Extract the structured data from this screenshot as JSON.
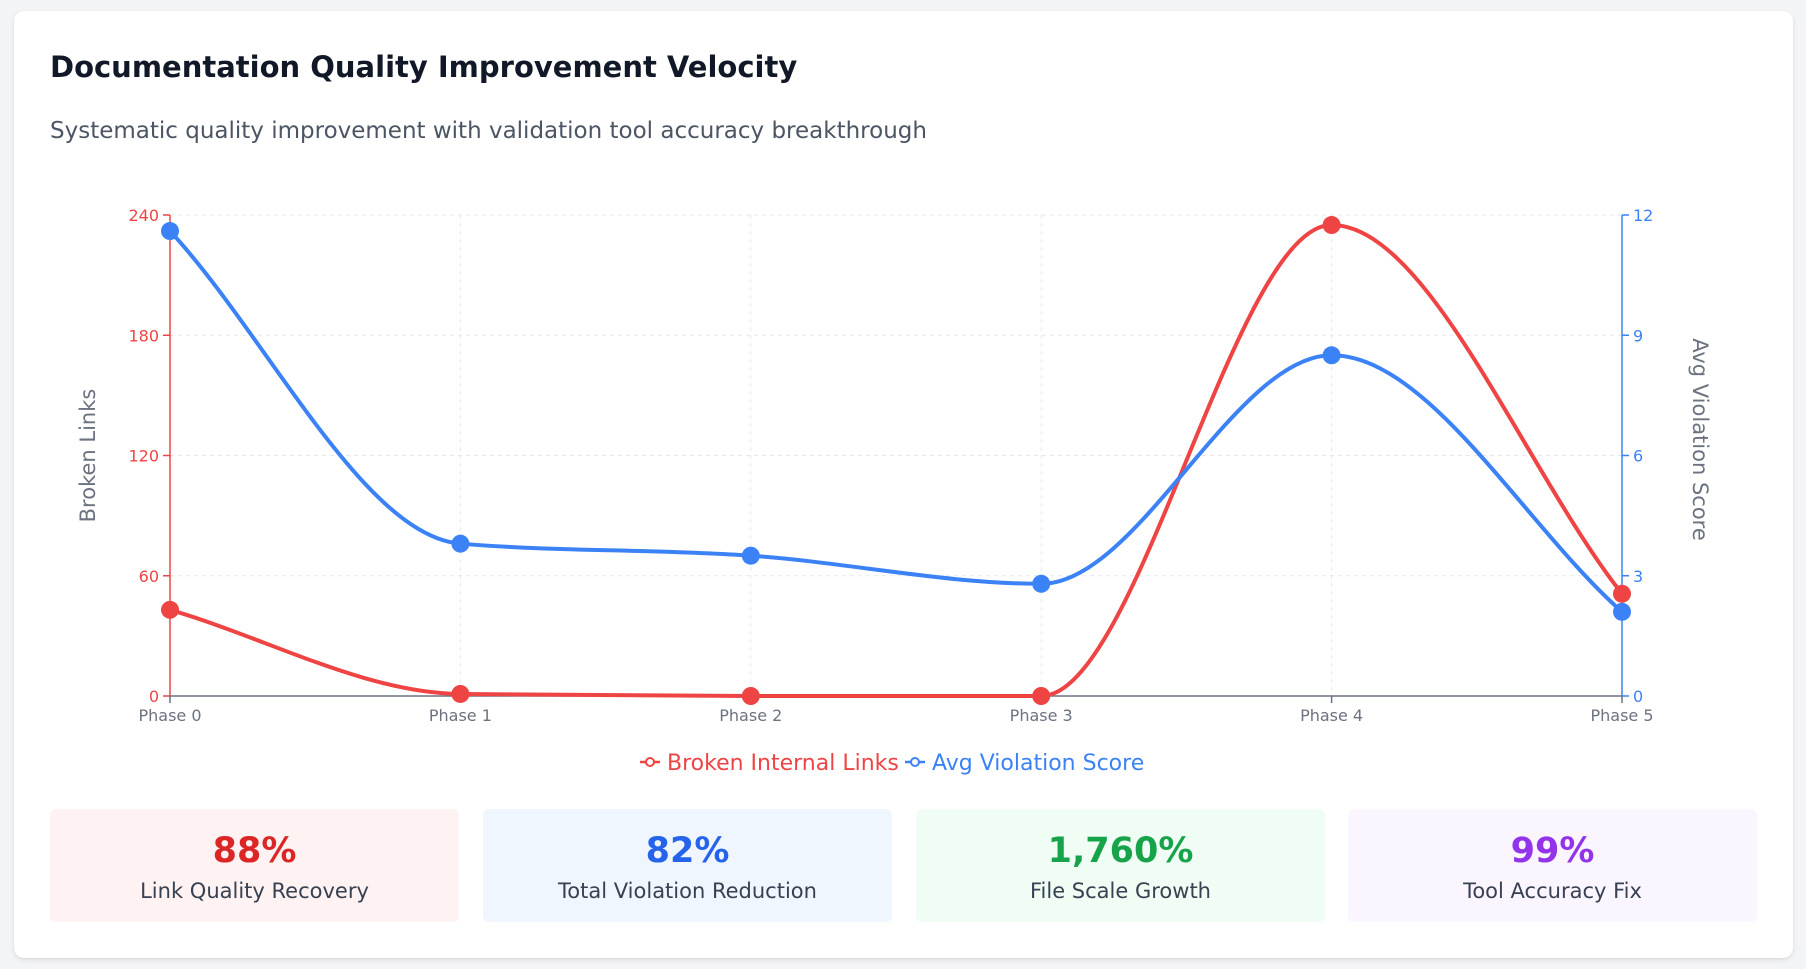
{
  "header": {
    "title": "Documentation Quality Improvement Velocity",
    "subtitle": "Systematic quality improvement with validation tool accuracy breakthrough"
  },
  "colors": {
    "broken_links": "#ef4444",
    "violation_score": "#3b82f6",
    "grid": "#e5e7eb",
    "axis": "#6b7280"
  },
  "chart_data": {
    "type": "line",
    "categories": [
      "Phase 0",
      "Phase 1",
      "Phase 2",
      "Phase 3",
      "Phase 4",
      "Phase 5"
    ],
    "series": [
      {
        "name": "Broken Internal Links",
        "axis": "left",
        "color": "#ef4444",
        "values": [
          43,
          1,
          0,
          0,
          235,
          51
        ]
      },
      {
        "name": "Avg Violation Score",
        "axis": "right",
        "color": "#3b82f6",
        "values": [
          11.6,
          3.8,
          3.5,
          2.8,
          8.5,
          2.1
        ]
      }
    ],
    "y_left": {
      "label": "Broken Links",
      "range": [
        0,
        240
      ],
      "ticks": [
        "0",
        "60",
        "120",
        "180",
        "240"
      ]
    },
    "y_right": {
      "label": "Avg Violation Score",
      "range": [
        0,
        12
      ],
      "ticks": [
        "0",
        "3",
        "6",
        "9",
        "12"
      ]
    },
    "grid": true,
    "legend_position": "bottom-center",
    "curve": "smooth"
  },
  "stats": [
    {
      "value": "88%",
      "label": "Link Quality Recovery",
      "color": "#dc2626",
      "bg": "#fef2f2"
    },
    {
      "value": "82%",
      "label": "Total Violation Reduction",
      "color": "#2563eb",
      "bg": "#eff6ff"
    },
    {
      "value": "1,760%",
      "label": "File Scale Growth",
      "color": "#16a34a",
      "bg": "#f0fdf4"
    },
    {
      "value": "99%",
      "label": "Tool Accuracy Fix",
      "color": "#9333ea",
      "bg": "#faf5ff"
    }
  ]
}
